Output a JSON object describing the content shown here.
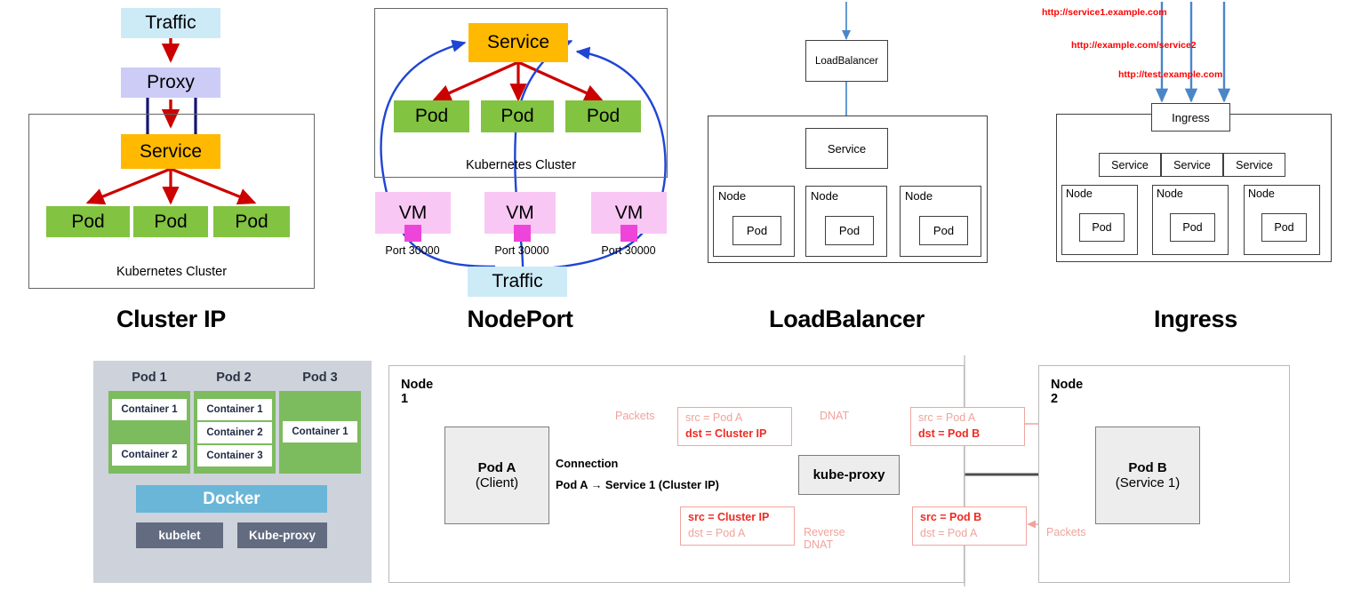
{
  "diagrams": {
    "cluster_ip": {
      "title": "Cluster IP",
      "traffic": "Traffic",
      "proxy": "Proxy",
      "service": "Service",
      "pods": [
        "Pod",
        "Pod",
        "Pod"
      ],
      "cluster_label": "Kubernetes Cluster"
    },
    "nodeport": {
      "title": "NodePort",
      "service": "Service",
      "pods": [
        "Pod",
        "Pod",
        "Pod"
      ],
      "cluster_label": "Kubernetes Cluster",
      "vms": [
        "VM",
        "VM",
        "VM"
      ],
      "ports": [
        "Port 30000",
        "Port 30000",
        "Port 30000"
      ],
      "traffic": "Traffic"
    },
    "loadbalancer": {
      "title": "LoadBalancer",
      "lb": "LoadBalancer",
      "service": "Service",
      "nodes": [
        "Node",
        "Node",
        "Node"
      ],
      "pods": [
        "Pod",
        "Pod",
        "Pod"
      ]
    },
    "ingress": {
      "title": "Ingress",
      "urls": [
        "http://service1.example.com",
        "http://example.com/service2",
        "http://test.example.com"
      ],
      "ingress": "Ingress",
      "services": [
        "Service",
        "Service",
        "Service"
      ],
      "nodes": [
        "Node",
        "Node",
        "Node"
      ],
      "pods": [
        "Pod",
        "Pod",
        "Pod"
      ]
    },
    "pod_anatomy": {
      "pod_titles": [
        "Pod 1",
        "Pod 2",
        "Pod 3"
      ],
      "pod1_containers": [
        "Container 1",
        "Container 2"
      ],
      "pod2_containers": [
        "Container 1",
        "Container 2",
        "Container 3"
      ],
      "pod3_containers": [
        "Container 1"
      ],
      "docker": "Docker",
      "kubelet": "kubelet",
      "kube_proxy": "Kube-proxy"
    },
    "dnat_flow": {
      "node1_title": "Node 1",
      "node2_title": "Node 2",
      "pod_a_name": "Pod A",
      "pod_a_role": "(Client)",
      "pod_b_name": "Pod B",
      "pod_b_role": "(Service 1)",
      "kube_proxy": "kube-proxy",
      "connection_label_top": "Connection",
      "connection_label_bottom": "Pod A → Service 1 (Cluster IP)",
      "packets_in_label": "Packets",
      "packets_out_label": "Packets",
      "dnat_label": "DNAT",
      "reverse_dnat_label": "Reverse DNAT",
      "pkt_top_left": {
        "src": "src = Pod A",
        "dst": "dst = Cluster IP"
      },
      "pkt_top_right": {
        "src": "src = Pod A",
        "dst": "dst = Pod B"
      },
      "pkt_bottom_left": {
        "src": "src = Cluster IP",
        "dst": "dst = Pod A"
      },
      "pkt_bottom_right": {
        "src": "src = Pod B",
        "dst": "dst = Pod A"
      }
    }
  },
  "colors": {
    "traffic": "#cdeaf7",
    "proxy": "#ccccf7",
    "service": "#ffb901",
    "pod": "#82c341",
    "vm": "#f9c7f4",
    "port": "#ef44d9",
    "red_arrow": "#cc0000",
    "blue_arrow": "#1f45d4",
    "navy_line": "#151570",
    "steel_arrow": "#4a86c8",
    "url_red": "#ff0000",
    "panel_bg": "#ced2da",
    "pod_green": "#7cbb5e",
    "docker_blue": "#69b6d8",
    "agent_gray": "#626b80",
    "packet_pink": "#f0a39c",
    "packet_hot": "#ef2a23",
    "flow_dark": "#4d4d4d"
  }
}
